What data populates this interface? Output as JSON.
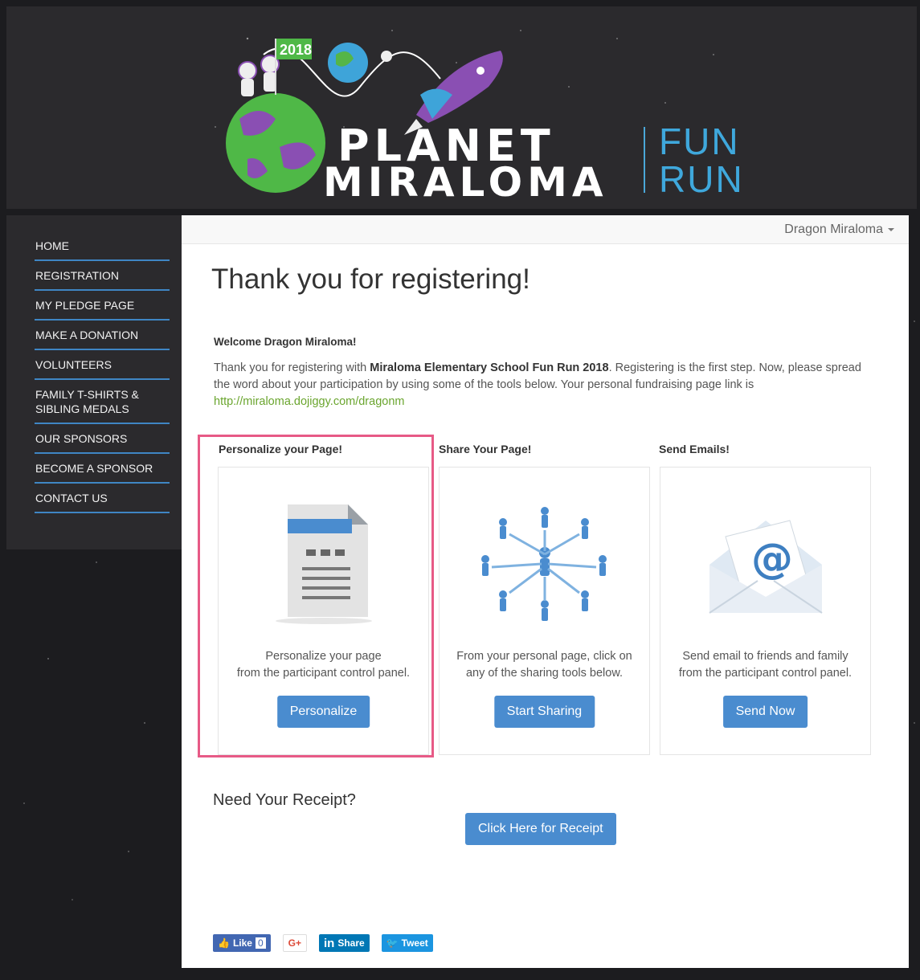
{
  "header": {
    "logo_year": "2018",
    "logo_word_1": "PLANET",
    "logo_word_2": "MIRALOMA",
    "logo_word_3": "FUN",
    "logo_word_4": "RUN"
  },
  "sidebar": {
    "items": [
      {
        "label": "HOME"
      },
      {
        "label": "REGISTRATION"
      },
      {
        "label": "MY PLEDGE PAGE"
      },
      {
        "label": "MAKE A DONATION"
      },
      {
        "label": "VOLUNTEERS"
      },
      {
        "label": "FAMILY T-SHIRTS & SIBLING MEDALS"
      },
      {
        "label": "OUR SPONSORS"
      },
      {
        "label": "BECOME A SPONSOR"
      },
      {
        "label": "CONTACT US"
      }
    ]
  },
  "topbar": {
    "user_name": "Dragon Miraloma"
  },
  "main": {
    "title": "Thank you for registering!",
    "welcome": "Welcome Dragon Miraloma!",
    "intro_1": "Thank you for registering with ",
    "intro_bold": "Miraloma Elementary School Fun Run 2018",
    "intro_2": ". Registering is the first step. Now, please spread the word about your participation by using some of the tools below. Your personal fundraising page link is ",
    "intro_link": "http://miraloma.dojiggy.com/dragonm"
  },
  "cards": [
    {
      "title": "Personalize your Page!",
      "text_line1": "Personalize your page",
      "text_line2": "from the participant control panel.",
      "button": "Personalize",
      "icon": "document-icon"
    },
    {
      "title": "Share Your Page!",
      "text_line1": "From your personal page, click on",
      "text_line2": "any of the sharing tools below.",
      "button": "Start Sharing",
      "icon": "network-people-icon"
    },
    {
      "title": "Send Emails!",
      "text_line1": "Send email to friends and family",
      "text_line2": "from the participant control panel.",
      "button": "Send Now",
      "icon": "email-envelope-icon"
    }
  ],
  "receipt": {
    "heading": "Need Your Receipt?",
    "button": "Click Here for Receipt"
  },
  "social": {
    "like": "Like",
    "like_count": "0",
    "gplus": "G+",
    "linkedin": "Share",
    "tweet": "Tweet"
  },
  "colors": {
    "accent": "#4a8ccf",
    "highlight": "#e75a86",
    "nav_underline": "#3f86c4",
    "link": "#6aa52e"
  }
}
